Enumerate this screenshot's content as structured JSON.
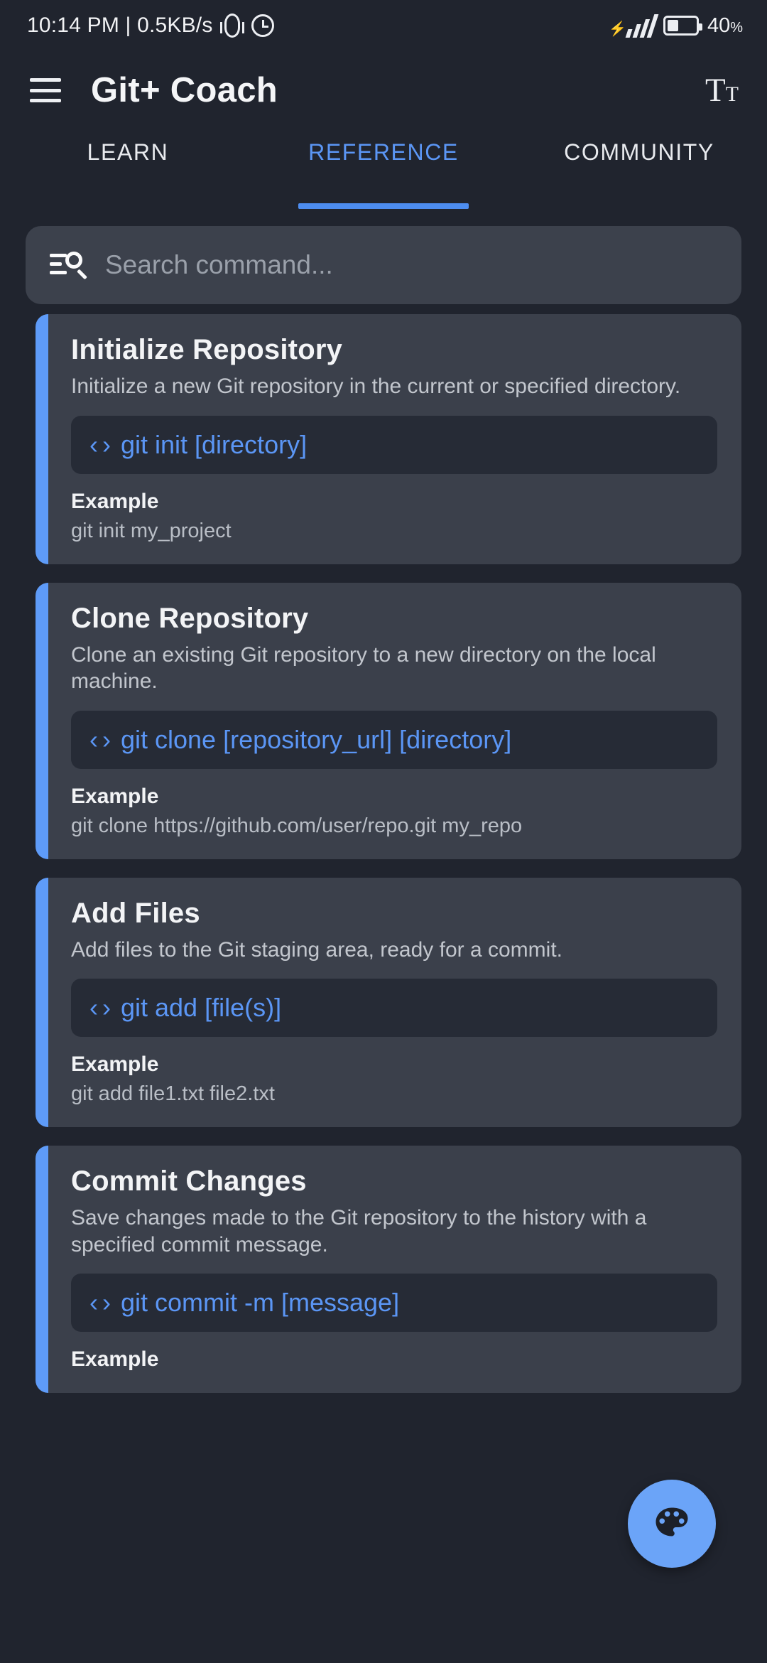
{
  "status_bar": {
    "time_and_speed": "10:14 PM | 0.5KB/s",
    "battery_percent": "40",
    "battery_unit": "%",
    "icons": [
      "vibrate-icon",
      "alarm-clock-icon",
      "signal-icon",
      "battery-icon"
    ]
  },
  "app_bar": {
    "title": "Git+ Coach",
    "menu_icon": "hamburger-menu-icon",
    "text_size_icon_large": "T",
    "text_size_icon_small": "T"
  },
  "tabs": [
    {
      "label": "LEARN",
      "active": false
    },
    {
      "label": "REFERENCE",
      "active": true
    },
    {
      "label": "COMMUNITY",
      "active": false
    }
  ],
  "search": {
    "placeholder": "Search command...",
    "icon": "manage-search-icon"
  },
  "example_label": "Example",
  "code_icon": "‹ ›",
  "cards": [
    {
      "title": "Initialize Repository",
      "description": "Initialize a new Git repository in the current or specified directory.",
      "command": "git init [directory]",
      "example_label": "Example",
      "example": "git init my_project"
    },
    {
      "title": "Clone Repository",
      "description": "Clone an existing Git repository to a new directory on the local machine.",
      "command": "git clone [repository_url] [directory]",
      "example_label": "Example",
      "example": "git clone https://github.com/user/repo.git my_repo"
    },
    {
      "title": "Add Files",
      "description": "Add files to the Git staging area, ready for a commit.",
      "command": "git add [file(s)]",
      "example_label": "Example",
      "example": "git add file1.txt file2.txt"
    },
    {
      "title": "Commit Changes",
      "description": "Save changes made to the Git repository to the history with a specified commit message.",
      "command": "git commit -m [message]",
      "example_label": "Example",
      "example": ""
    }
  ],
  "fab": {
    "icon": "palette-icon"
  },
  "colors": {
    "background": "#20242e",
    "card": "#3b404b",
    "code_block": "#262b36",
    "accent_blue": "#5e9bf8",
    "tab_active": "#5b96f5",
    "fab": "#6ba4f8"
  }
}
